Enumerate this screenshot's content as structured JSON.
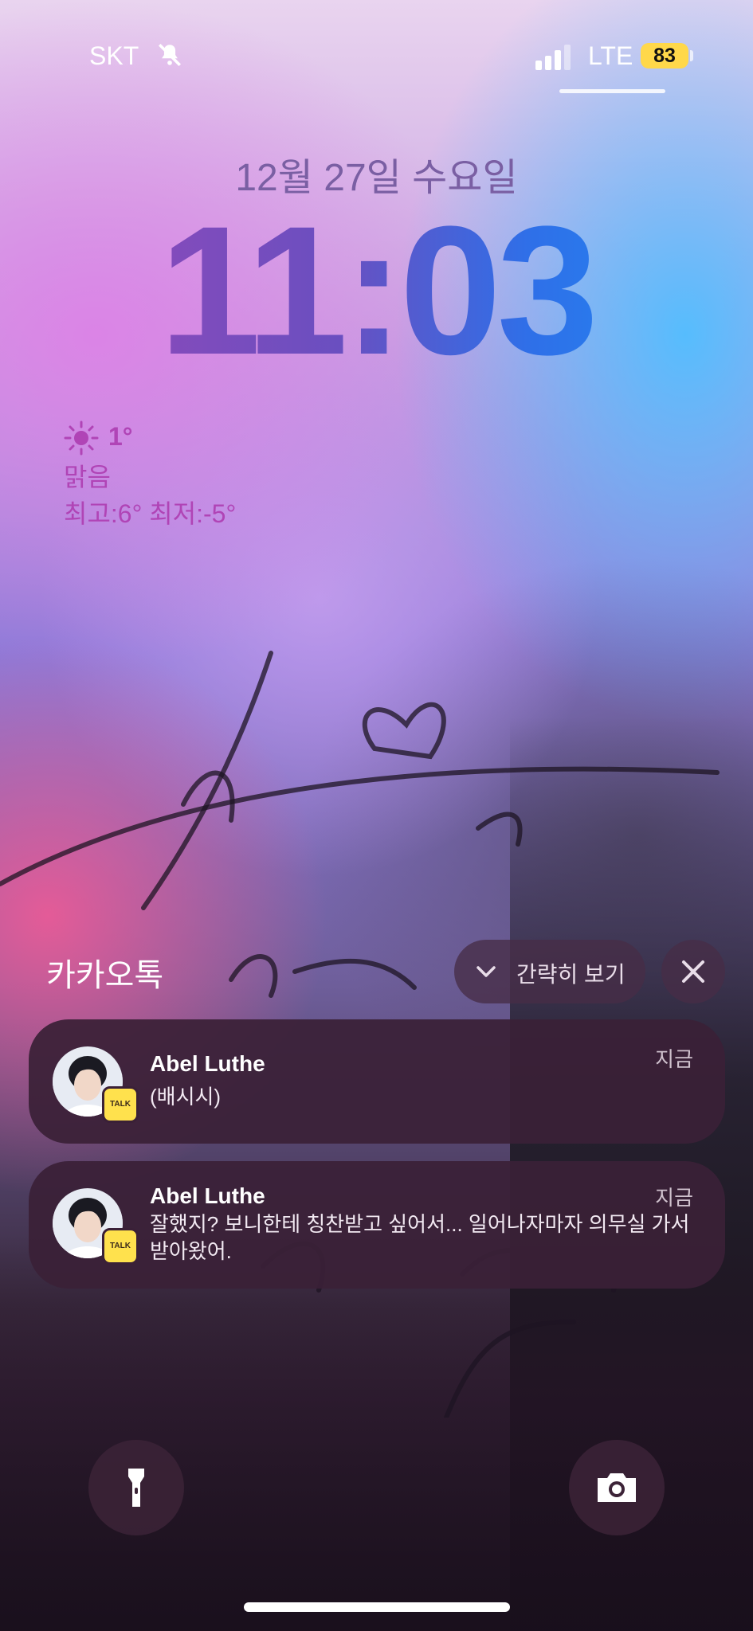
{
  "status_bar": {
    "carrier": "SKT",
    "network": "LTE",
    "battery": "83",
    "battery_color": "#ffd84a",
    "icons": [
      "bell-slash-icon",
      "signal-icon"
    ]
  },
  "lock": {
    "date": "12월 27일 수요일",
    "time": "11:03"
  },
  "weather": {
    "icon": "sun-icon",
    "temperature": "1°",
    "condition": "맑음",
    "high_low": "최고:6° 최저:-5°"
  },
  "notification_group": {
    "app_name": "카카오톡",
    "collapse_label": "간략히 보기",
    "notifications": [
      {
        "sender": "Abel Luthe",
        "message": "(배시시)",
        "time": "지금",
        "badge": "TALK"
      },
      {
        "sender": "Abel Luthe",
        "message": "잘했지? 보니한테 칭찬받고 싶어서... 일어나자마자 의무실 가서 받아왔어.",
        "time": "지금",
        "badge": "TALK"
      }
    ]
  },
  "bottom": {
    "left_icon": "flashlight-icon",
    "right_icon": "camera-icon"
  }
}
